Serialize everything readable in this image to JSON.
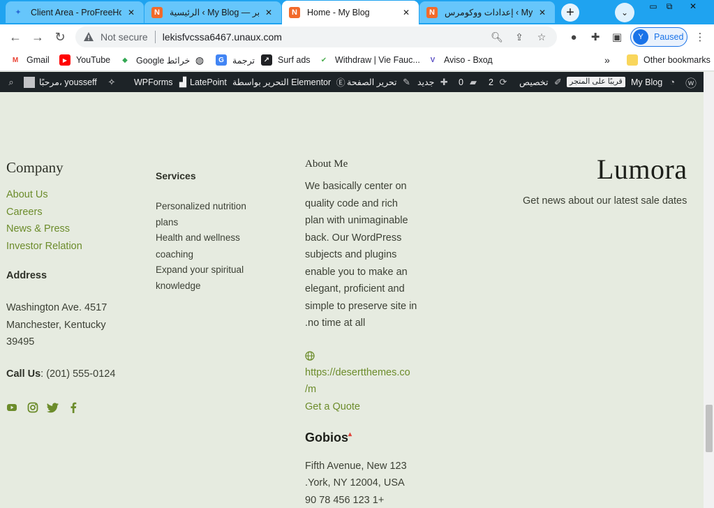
{
  "browser": {
    "tabs": [
      {
        "title": "Client Area - ProFreeHost",
        "favicon": "P"
      },
      {
        "title": "الرئيسية ‹ My Blog — ووردبر",
        "favicon": "N"
      },
      {
        "title": "Home - My Blog",
        "favicon": "N"
      },
      {
        "title": "إعدادات ووكومرس ‹ My Blog",
        "favicon": "N"
      }
    ],
    "not_secure": "Not secure",
    "url": "lekisfvcssa6467.unaux.com",
    "profile_initial": "Y",
    "profile_status": "Paused"
  },
  "bookmarks": {
    "items": [
      {
        "label": "Gmail"
      },
      {
        "label": "YouTube"
      },
      {
        "label": "Google خرائط"
      },
      {
        "label": ""
      },
      {
        "label": "ترجمة"
      },
      {
        "label": "Surf ads"
      },
      {
        "label": "Withdraw | Vie Fauc..."
      },
      {
        "label": "Aviso - Вход"
      }
    ],
    "more": "»",
    "other": "Other bookmarks"
  },
  "adminbar": {
    "greeting": "مرحبًا، yousseff",
    "wpforms": "WPForms",
    "latepoint": "LatePoint",
    "elementor": "التحرير بواسطة Elementor",
    "edit_page": "تحرير الصفحة",
    "new": "جديد",
    "comments": "0",
    "updates": "2",
    "customize": "تخصيص",
    "store_soon": "قريبًا على المتجر",
    "site_name": "My Blog"
  },
  "footer": {
    "company": {
      "heading": "Company",
      "links": [
        "About Us",
        "Careers",
        "News & Press",
        "Investor Relation"
      ]
    },
    "address": {
      "heading": "Address",
      "lines": [
        "Washington Ave. 4517",
        "Manchester, Kentucky",
        "39495"
      ],
      "call_label": "Call Us",
      "call_value": ": (201) 555-0124"
    },
    "services": {
      "heading": "Services",
      "lines": [
        "Personalized nutrition",
        "plans",
        "Health and wellness",
        "coaching",
        "Expand your spiritual",
        "knowledge"
      ]
    },
    "about": {
      "heading": "About Me",
      "lines": [
        "We basically center on",
        "quality code and rich",
        "plan with unimaginable",
        "back. Our WordPress",
        "subjects and plugins",
        "enable you to make an",
        "elegant, proficient and",
        "simple to preserve site in",
        ".no time at all"
      ],
      "link_lines": [
        "https://desertthemes.co",
        "/m"
      ],
      "quote": "Get a Quote"
    },
    "gobios": {
      "title": "Gobios",
      "lines": [
        "Fifth Avenue, New 123",
        ".York, NY 12004, USA",
        "90 78 456 123 1+"
      ]
    },
    "brand": {
      "logo": "Lumora",
      "tagline": "Get news about our latest sale dates"
    },
    "social_icons": [
      "youtube-icon",
      "instagram-icon",
      "twitter-icon",
      "facebook-icon"
    ],
    "colors": {
      "accent": "#6c8c2b",
      "background": "#e6ebe0",
      "text": "#3c4035"
    }
  }
}
